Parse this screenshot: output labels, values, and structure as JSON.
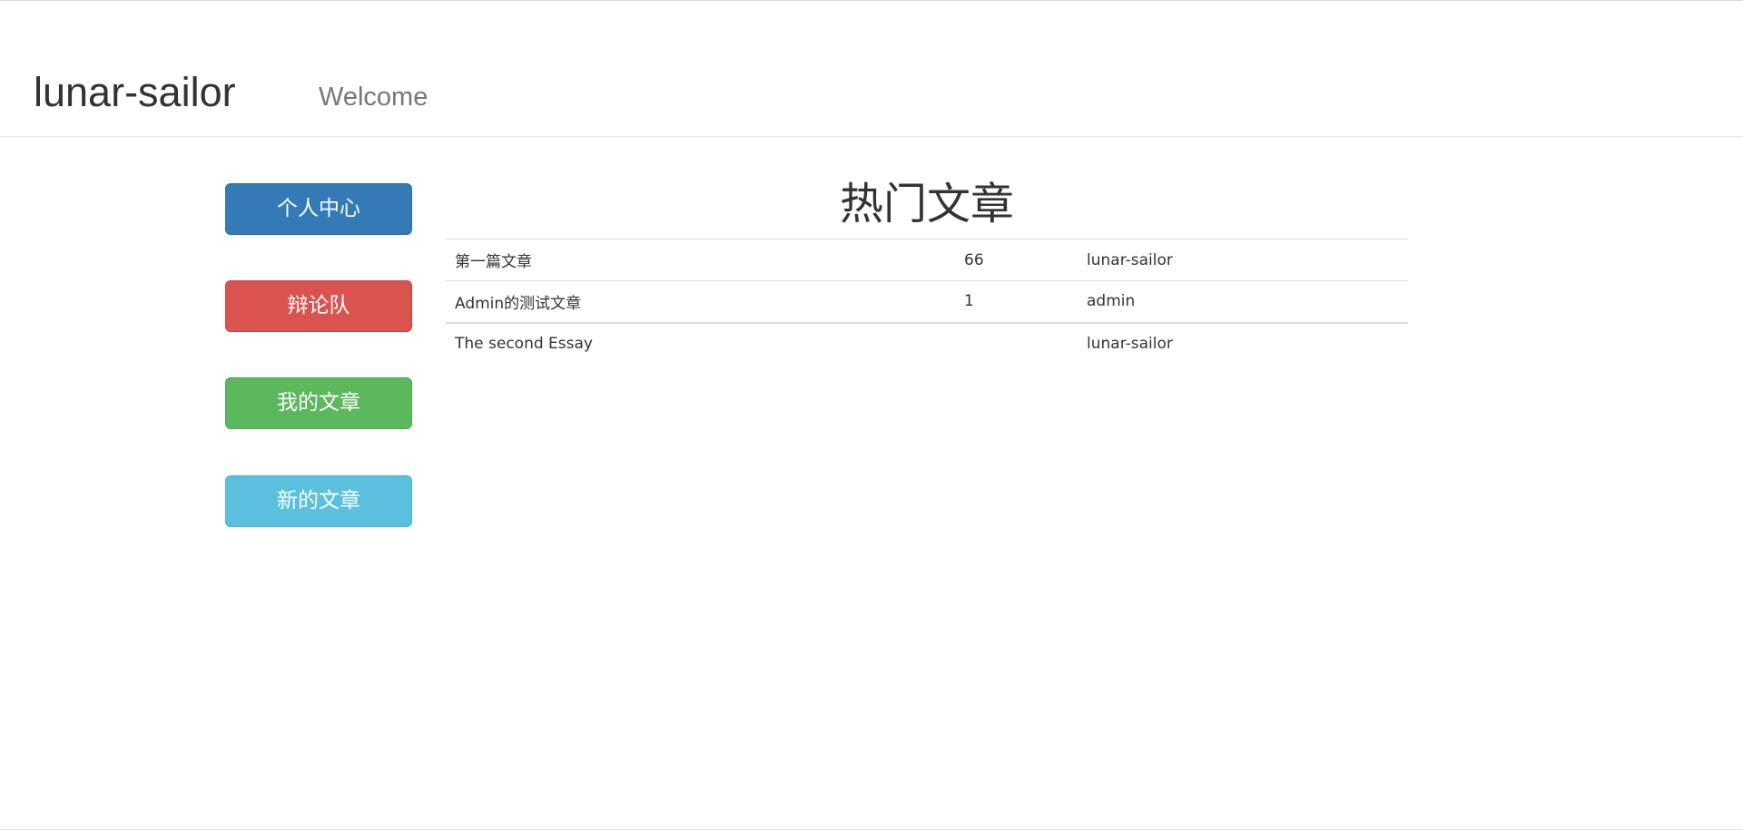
{
  "navbar": {
    "brand": "lunar-sailor",
    "welcome": "Welcome"
  },
  "sidebar": {
    "buttons": [
      {
        "label": "个人中心",
        "color": "#337ab7"
      },
      {
        "label": "辩论队",
        "color": "#d9534f"
      },
      {
        "label": "我的文章",
        "color": "#5cb85c"
      },
      {
        "label": "新的文章",
        "color": "#5bc0de"
      }
    ]
  },
  "main": {
    "title": "热门文章",
    "articles": [
      {
        "title": "第一篇文章",
        "count": "66",
        "author": "lunar-sailor"
      },
      {
        "title": "Admin的测试文章",
        "count": "1",
        "author": "admin"
      },
      {
        "title": "The second Essay",
        "count": "",
        "author": "lunar-sailor"
      }
    ]
  }
}
